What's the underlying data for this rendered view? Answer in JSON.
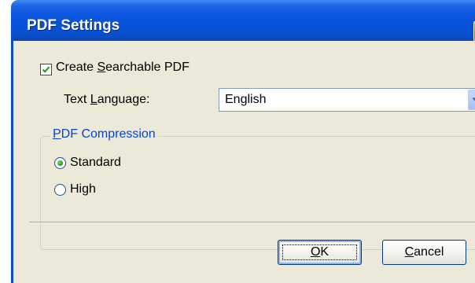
{
  "dialog": {
    "title": "PDF Settings",
    "close_glyph": "✕"
  },
  "searchable": {
    "checked": true,
    "label_before": "Create ",
    "label_mnemonic": "S",
    "label_after": "earchable PDF"
  },
  "language": {
    "label_before": "Text ",
    "label_mnemonic": "L",
    "label_after": "anguage:",
    "value": "English"
  },
  "compression": {
    "group_mnemonic": "P",
    "group_after": "DF Compression",
    "options": [
      {
        "label": "Standard",
        "selected": true
      },
      {
        "label": "High",
        "selected": false
      }
    ]
  },
  "buttons": {
    "ok_mnemonic": "O",
    "ok_after": "K",
    "cancel_mnemonic": "C",
    "cancel_after": "ancel"
  },
  "colors": {
    "titlebar": "#0751d8",
    "client": "#ece9d8",
    "group_title": "#0046d5",
    "close_button": "#d9502d"
  }
}
